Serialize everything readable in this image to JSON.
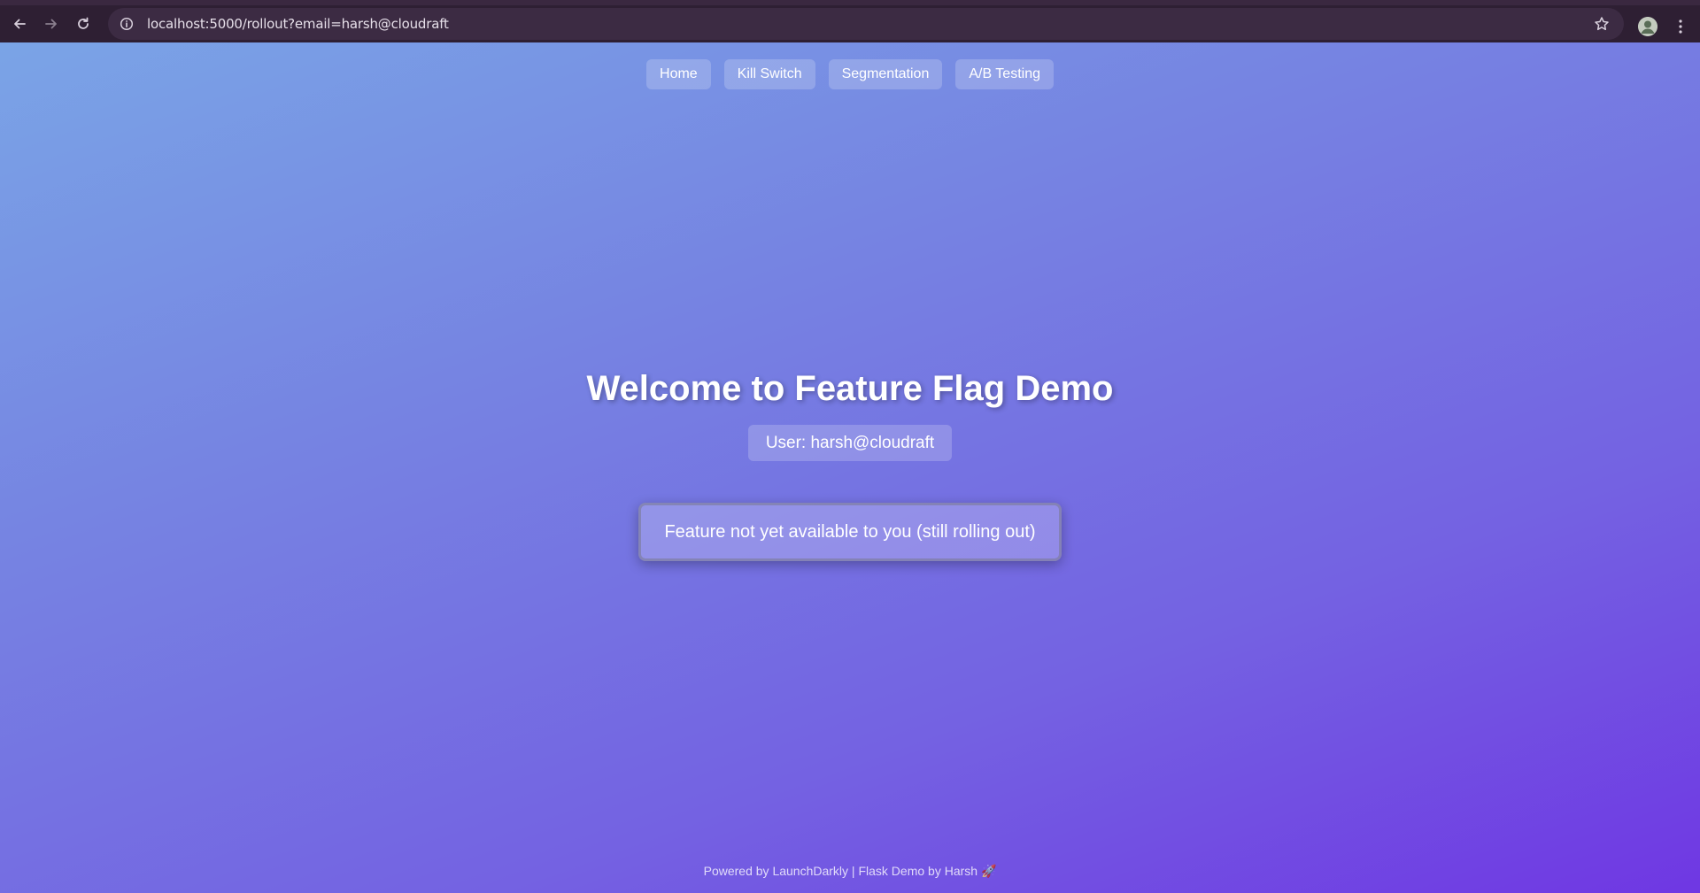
{
  "browser": {
    "url": "localhost:5000/rollout?email=harsh@cloudraft"
  },
  "nav": {
    "items": [
      {
        "label": "Home"
      },
      {
        "label": "Kill Switch"
      },
      {
        "label": "Segmentation"
      },
      {
        "label": "A/B Testing"
      }
    ]
  },
  "hero": {
    "title": "Welcome to Feature Flag Demo",
    "user_label": "User: harsh@cloudraft"
  },
  "status": {
    "message": "Feature not yet available to you (still rolling out)"
  },
  "footer": {
    "text": "Powered by LaunchDarkly | Flask Demo by Harsh 🚀"
  },
  "icons": {
    "back": "arrow-left-icon",
    "forward": "arrow-right-icon",
    "reload": "reload-icon",
    "site_info": "info-icon",
    "bookmark": "star-icon",
    "profile": "avatar",
    "menu": "kebab-menu-icon"
  },
  "colors": {
    "chrome_bg": "#2e1f33",
    "omnibox_bg": "#3c2b43",
    "gradient_start": "#7aa4e6",
    "gradient_end": "#6f37e3"
  }
}
